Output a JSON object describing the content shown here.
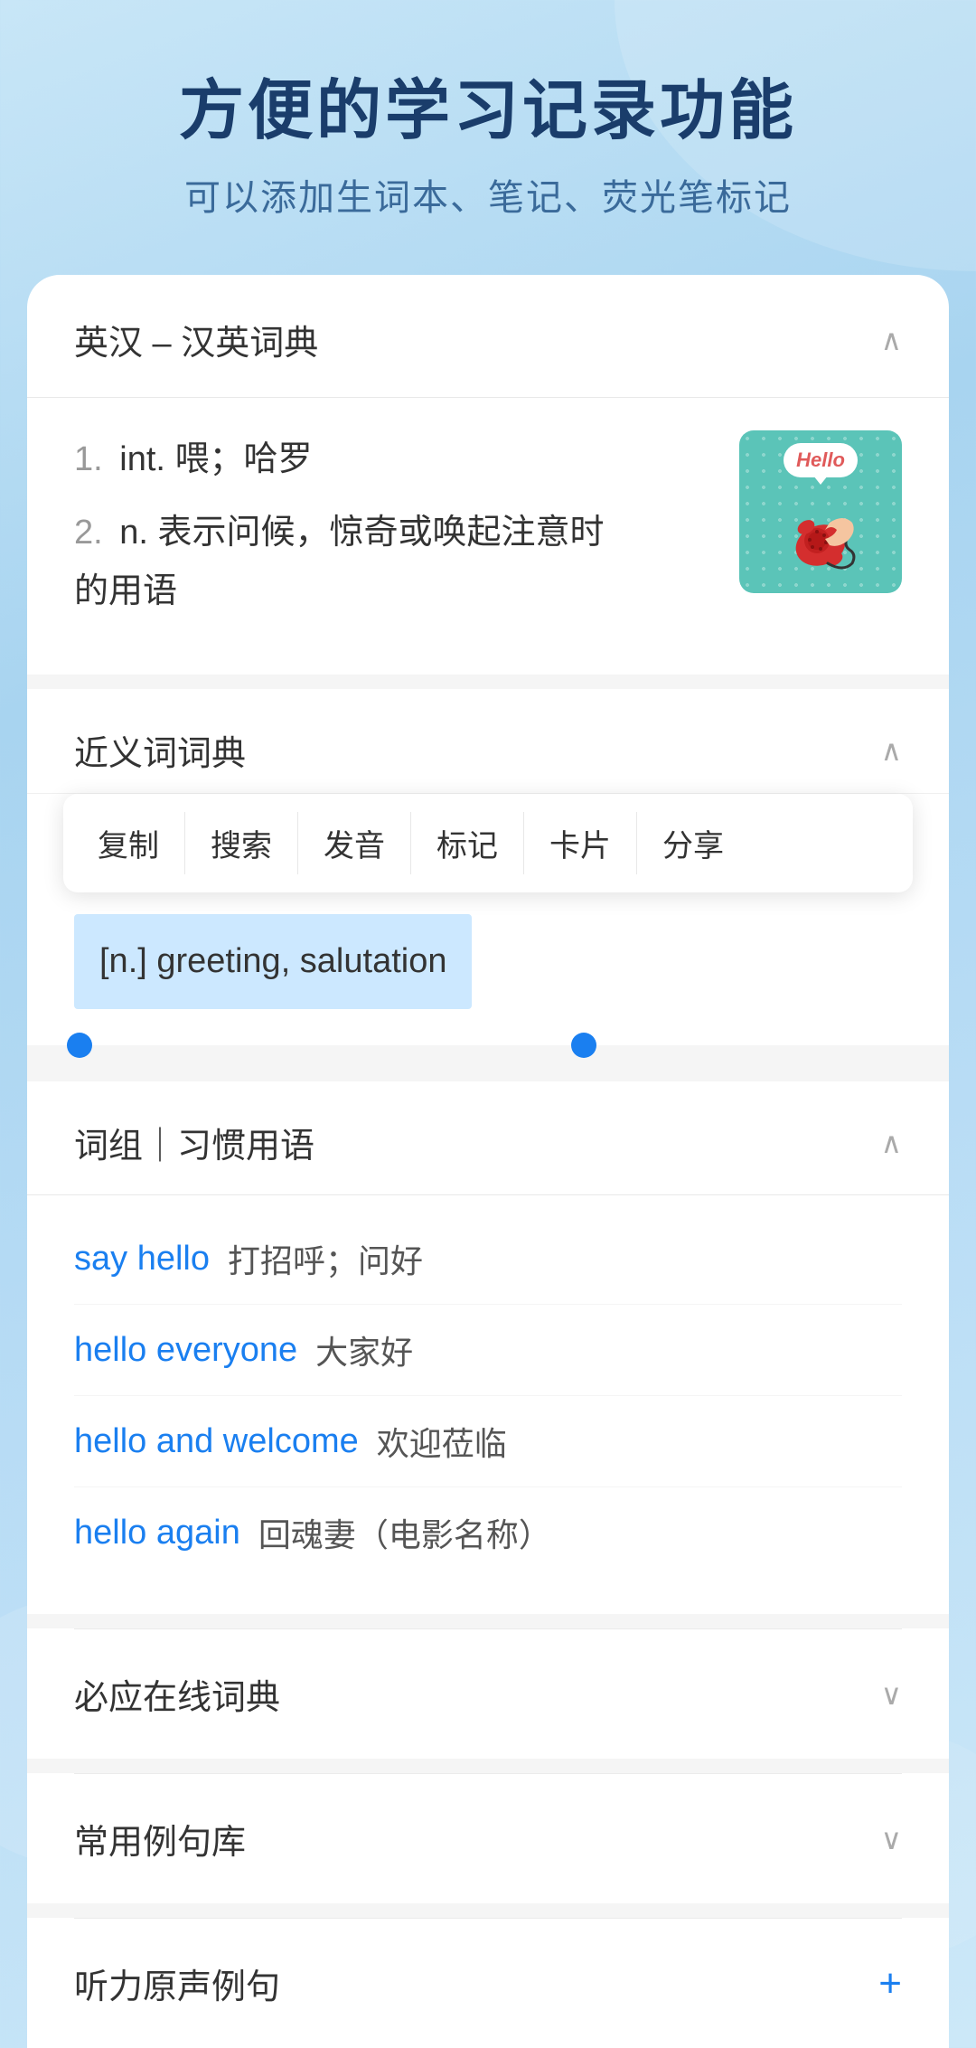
{
  "header": {
    "main_title": "方便的学习记录功能",
    "subtitle": "可以添加生词本、笔记、荧光笔标记"
  },
  "dictionary_section": {
    "title": "英汉 – 汉英词典",
    "chevron": "∧",
    "definitions": [
      {
        "number": "1.",
        "pos": "int.",
        "text": "喂；哈罗"
      },
      {
        "number": "2.",
        "pos": "n.",
        "text": "表示问候，惊奇或唤起注意时的用语"
      }
    ],
    "image_alt": "Hello telephone illustration"
  },
  "synonym_section": {
    "title": "近义词词典",
    "chevron": "∧",
    "context_menu": {
      "items": [
        "复制",
        "搜索",
        "发音",
        "标记",
        "卡片",
        "分享"
      ]
    },
    "selected_text": "[n.] greeting, salutation"
  },
  "phrases_section": {
    "title": "词组｜习惯用语",
    "chevron": "∧",
    "phrases": [
      {
        "en": "say hello",
        "zh": "打招呼；问好"
      },
      {
        "en": "hello everyone",
        "zh": "大家好"
      },
      {
        "en": "hello and welcome",
        "zh": "欢迎莅临"
      },
      {
        "en": "hello again",
        "zh": "回魂妻（电影名称）"
      }
    ]
  },
  "collapsed_sections": [
    {
      "title": "必应在线词典",
      "icon": "chevron-down"
    },
    {
      "title": "常用例句库",
      "icon": "chevron-down"
    }
  ],
  "plus_section": {
    "title": "听力原声例句",
    "icon": "+"
  }
}
